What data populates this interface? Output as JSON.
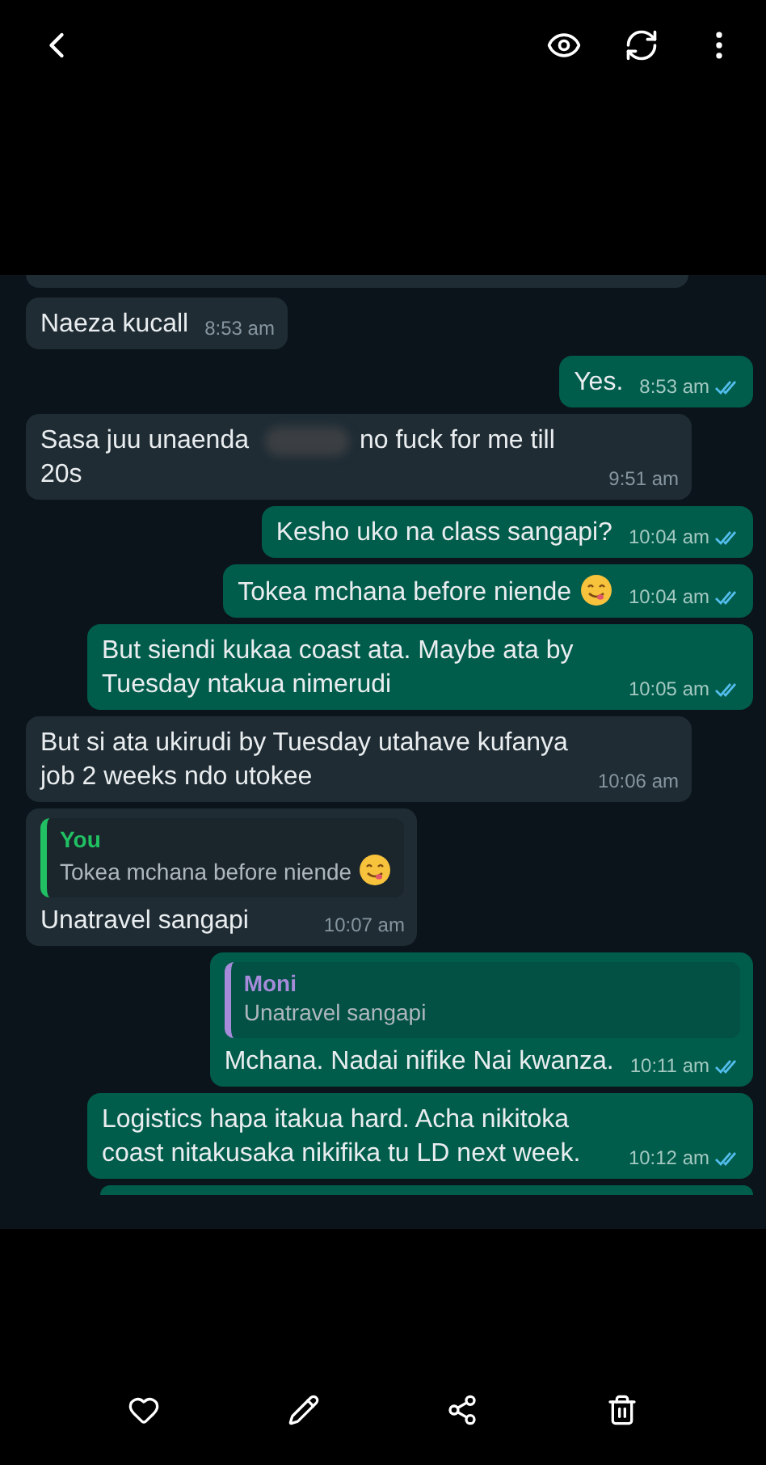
{
  "chat": {
    "messages": [
      {
        "kind": "in",
        "parts": [
          {
            "kind": "text",
            "text": "Naeza kucall"
          }
        ],
        "time": "8:53 am"
      },
      {
        "kind": "out",
        "parts": [
          {
            "kind": "text",
            "text": "Yes."
          }
        ],
        "time": "8:53 am",
        "read": true
      },
      {
        "kind": "in",
        "parts": [
          {
            "kind": "text",
            "text": "Sasa juu unaenda"
          },
          {
            "kind": "redacted"
          },
          {
            "kind": "text",
            "text": "no fuck for me till 20s"
          }
        ],
        "time": "9:51 am"
      },
      {
        "kind": "out",
        "parts": [
          {
            "kind": "text",
            "text": "Kesho uko na class sangapi?"
          }
        ],
        "time": "10:04 am",
        "read": true
      },
      {
        "kind": "out",
        "parts": [
          {
            "kind": "text",
            "text": "Tokea mchana before niende"
          },
          {
            "kind": "emoji"
          }
        ],
        "time": "10:04 am",
        "read": true
      },
      {
        "kind": "out",
        "parts": [
          {
            "kind": "text",
            "text": "But siendi kukaa coast ata. Maybe ata by Tuesday ntakua nimerudi"
          }
        ],
        "time": "10:05 am",
        "read": true
      },
      {
        "kind": "in",
        "parts": [
          {
            "kind": "text",
            "text": "But si ata ukirudi by Tuesday utahave kufanya job 2 weeks ndo utokee"
          }
        ],
        "time": "10:06 am"
      },
      {
        "kind": "in",
        "quote": {
          "author": "You",
          "color": "#21c063",
          "parts": [
            {
              "kind": "text",
              "text": "Tokea mchana before niende"
            },
            {
              "kind": "emoji"
            }
          ]
        },
        "parts": [
          {
            "kind": "text",
            "text": "Unatravel sangapi"
          }
        ],
        "time": "10:07 am"
      },
      {
        "kind": "out",
        "quote": {
          "author": "Moni",
          "color": "#a78bdb",
          "parts": [
            {
              "kind": "text",
              "text": "Unatravel sangapi"
            }
          ]
        },
        "parts": [
          {
            "kind": "text",
            "text": "Mchana. Nadai nifike Nai kwanza."
          }
        ],
        "time": "10:11 am",
        "read": true
      },
      {
        "kind": "out",
        "parts": [
          {
            "kind": "text",
            "text": "Logistics hapa itakua hard. Acha nikitoka coast nitakusaka nikifika tu LD next week."
          }
        ],
        "time": "10:12 am",
        "read": true
      }
    ]
  },
  "cut_off": true
}
